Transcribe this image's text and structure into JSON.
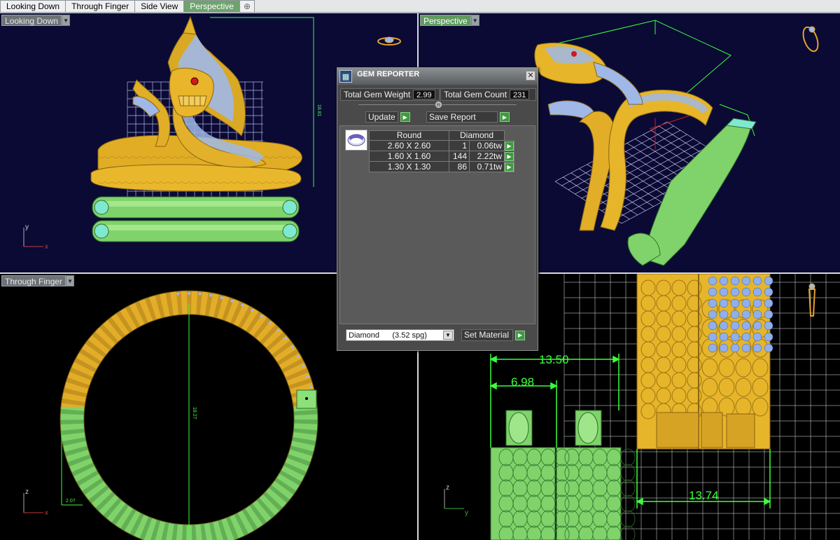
{
  "tabs": [
    {
      "label": "Looking Down",
      "active": false
    },
    {
      "label": "Through Finger",
      "active": false
    },
    {
      "label": "Side View",
      "active": false
    },
    {
      "label": "Perspective",
      "active": true
    }
  ],
  "add_tab_icon": "plus-icon",
  "viewports": {
    "looking_down": {
      "label": "Looking Down"
    },
    "perspective": {
      "label": "Perspective"
    },
    "through_finger": {
      "label": "Through Finger"
    },
    "side_view": {
      "dimensions": [
        "13.50",
        "6.98",
        "13.74"
      ]
    }
  },
  "axis_labels": {
    "x": "x",
    "y": "y",
    "z": "z"
  },
  "gem_reporter": {
    "title": "GEM REPORTER",
    "total_gem_weight_label": "Total Gem Weight",
    "total_gem_weight": "2.99",
    "total_gem_count_label": "Total Gem Count",
    "total_gem_count": "231",
    "update_label": "Update",
    "save_report_label": "Save Report",
    "table": {
      "headers": [
        "Round",
        "Diamond"
      ],
      "rows": [
        {
          "size": "2.60 X 2.60",
          "count": "1",
          "weight": "0.06tw"
        },
        {
          "size": "1.60 X 1.60",
          "count": "144",
          "weight": "2.22tw"
        },
        {
          "size": "1.30 X 1.30",
          "count": "86",
          "weight": "0.71tw"
        }
      ]
    },
    "material_value": "Diamond      (3.52 spg)",
    "set_material_label": "Set Material"
  },
  "colors": {
    "gold": "#e6b52a",
    "green_band": "#7fd36a",
    "gem_blue": "#9fb8e8",
    "dim_green": "#3cff3c",
    "grid": "#ffffff",
    "ruby": "#d11a1a"
  }
}
